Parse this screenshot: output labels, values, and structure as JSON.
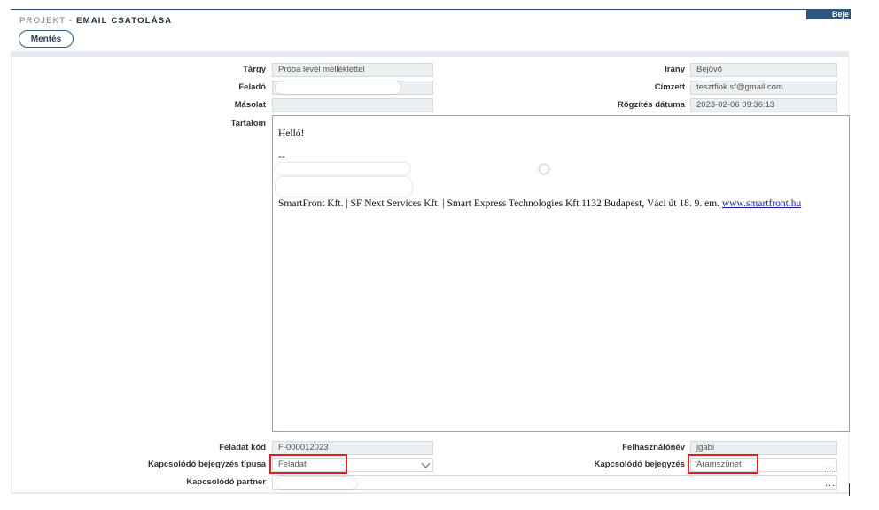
{
  "header": {
    "breadcrumb_prefix": "PROJEKT - ",
    "title": "EMAIL CSATOLÁSA",
    "badge": "Beje",
    "save_label": "Mentés"
  },
  "form": {
    "subject_label": "Tárgy",
    "subject_value": "Próba levél melléklettel",
    "sender_label": "Feladó",
    "cc_label": "Másolat",
    "content_label": "Tartalom",
    "direction_label": "Irány",
    "direction_value": "Bejövő",
    "recipient_label": "Címzett",
    "recipient_value": "tesztfiok.sf@gmail.com",
    "recorded_label": "Rögzítés dátuma",
    "recorded_value": "2023-02-06 09:36:13",
    "task_code_label": "Feladat kód",
    "task_code_value": "F-000012023",
    "username_label": "Felhasználónév",
    "username_value": "jgabi",
    "entry_type_label": "Kapcsolódó bejegyzés típusa",
    "entry_type_value": "Feladat",
    "entry_label": "Kapcsolódó bejegyzés",
    "entry_value": "Áramszünet",
    "partner_label": "Kapcsolódó partner",
    "lookup_dots": "..."
  },
  "email_body": {
    "greeting": "Helló!",
    "separator": "--",
    "signature": "SmartFront Kft. | SF Next Services Kft. | Smart Express Technologies Kft.1132 Budapest, Váci út 18. 9. em. ",
    "link": "www.smartfront.hu"
  },
  "colors": {
    "highlight": "#e21d1d",
    "accent": "#2a5680"
  }
}
